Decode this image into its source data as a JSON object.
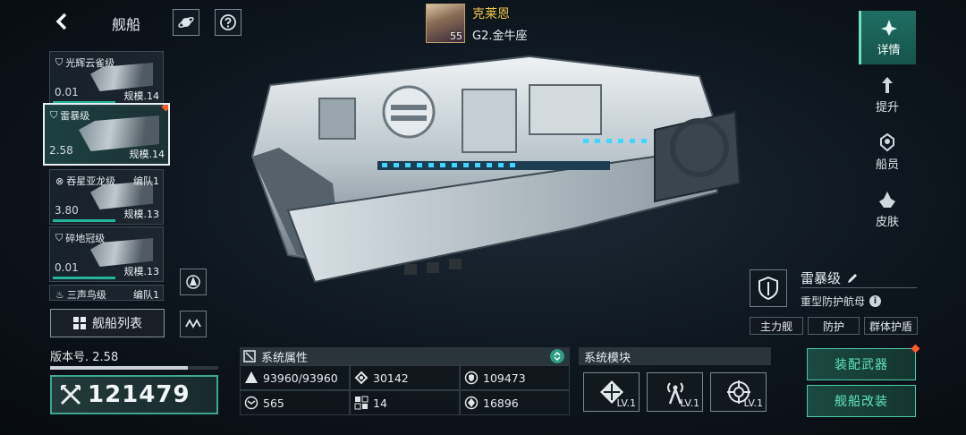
{
  "header": {
    "back_icon": "back-arrow-icon",
    "title": "舰船",
    "planet_icon": "planet-icon",
    "help_icon": "question-icon"
  },
  "player": {
    "name": "克莱恩",
    "level": "55",
    "rank": "G2.金牛座"
  },
  "ship_list": [
    {
      "name": "光辉云雀级",
      "value": "0.01",
      "scale": "规模.14",
      "fleet": ""
    },
    {
      "name": "雷暴级",
      "value": "2.58",
      "scale": "规模.14",
      "fleet": ""
    },
    {
      "name": "吞星亚龙级",
      "value": "3.80",
      "scale": "规模.13",
      "fleet": "编队1"
    },
    {
      "name": "碎地冠级",
      "value": "0.01",
      "scale": "规模.13",
      "fleet": ""
    },
    {
      "name": "三声鸟级",
      "value": "",
      "scale": "",
      "fleet": "编队1"
    }
  ],
  "list_button": "舰船列表",
  "version": {
    "label": "版本号. 2.58",
    "progress": 0.82
  },
  "power": "121479",
  "tabs": [
    {
      "label": "详情",
      "icon": "details-icon"
    },
    {
      "label": "提升",
      "icon": "upgrade-icon"
    },
    {
      "label": "船员",
      "icon": "crew-icon"
    },
    {
      "label": "皮肤",
      "icon": "skin-icon"
    }
  ],
  "ship": {
    "name": "雷暴级",
    "type": "重型防护航母",
    "tags": [
      "主力舰",
      "防护",
      "群体护盾"
    ]
  },
  "attributes": {
    "title": "系统属性",
    "items": [
      {
        "icon": "hull-icon",
        "value": "93960/93960"
      },
      {
        "icon": "armor-icon",
        "value": "30142"
      },
      {
        "icon": "shield-icon",
        "value": "109473"
      },
      {
        "icon": "speed-icon",
        "value": "565"
      },
      {
        "icon": "grid-icon",
        "value": "14"
      },
      {
        "icon": "energy-icon",
        "value": "16896"
      }
    ]
  },
  "modules": {
    "title": "系统模块",
    "items": [
      {
        "icon": "weapon-module-icon",
        "level": "LV.1"
      },
      {
        "icon": "antenna-module-icon",
        "level": "LV.1"
      },
      {
        "icon": "target-module-icon",
        "level": "LV.1"
      }
    ]
  },
  "actions": {
    "equip": "装配武器",
    "modify": "舰船改装"
  },
  "colors": {
    "accent": "#3fa78e",
    "gold": "#f2c84a",
    "alert": "#ff5a2a"
  }
}
